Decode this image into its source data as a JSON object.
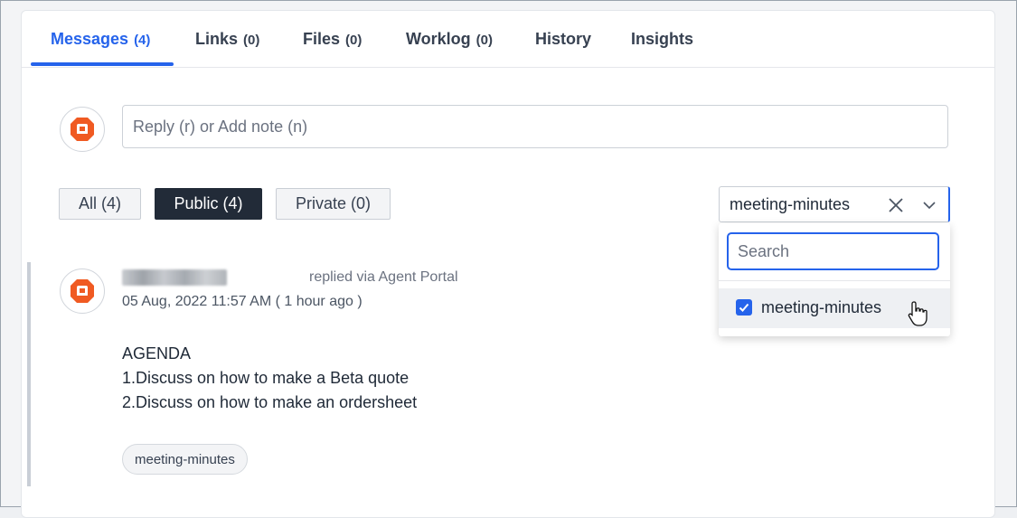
{
  "tabs": [
    {
      "label": "Messages",
      "count": "(4)"
    },
    {
      "label": "Links",
      "count": "(0)"
    },
    {
      "label": "Files",
      "count": "(0)"
    },
    {
      "label": "Worklog",
      "count": "(0)"
    },
    {
      "label": "History",
      "count": ""
    },
    {
      "label": "Insights",
      "count": ""
    }
  ],
  "active_tab": "Messages",
  "reply": {
    "placeholder": "Reply (r) or Add note (n)"
  },
  "filters": {
    "all": "All (4)",
    "public": "Public (4)",
    "private": "Private (0)",
    "active": "Public (4)"
  },
  "tag_filter": {
    "value": "meeting-minutes",
    "search_placeholder": "Search",
    "options": [
      {
        "label": "meeting-minutes",
        "checked": true
      }
    ]
  },
  "message": {
    "replied_via": "replied via Agent Portal",
    "timestamp": "05 Aug, 2022 11:57 AM ( 1 hour ago )",
    "body": [
      "AGENDA",
      "1.Discuss on how to make a Beta quote",
      "2.Discuss on how to make an ordersheet"
    ],
    "tag": "meeting-minutes"
  },
  "colors": {
    "accent": "#2563eb",
    "active_filter": "#222b38",
    "logo": "#f05a22"
  }
}
